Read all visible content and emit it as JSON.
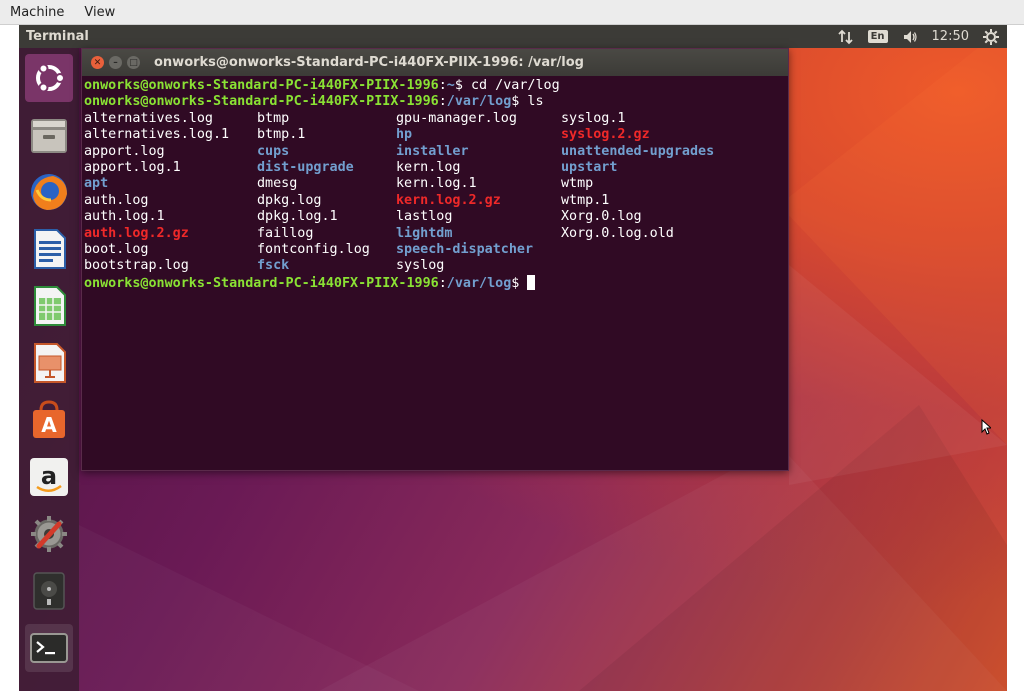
{
  "host_menu": {
    "items": [
      "Machine",
      "View"
    ]
  },
  "top_panel": {
    "app_title": "Terminal",
    "language": "En",
    "time": "12:50"
  },
  "launcher": {
    "items": [
      {
        "name": "dash-home",
        "icon": "ubuntu-logo-icon"
      },
      {
        "name": "files",
        "icon": "file-cabinet-icon"
      },
      {
        "name": "firefox",
        "icon": "firefox-icon"
      },
      {
        "name": "writer",
        "icon": "libreoffice-writer-icon"
      },
      {
        "name": "calc",
        "icon": "libreoffice-calc-icon"
      },
      {
        "name": "impress",
        "icon": "libreoffice-impress-icon"
      },
      {
        "name": "software-center",
        "icon": "ubuntu-software-icon"
      },
      {
        "name": "amazon",
        "icon": "amazon-icon"
      },
      {
        "name": "settings",
        "icon": "system-settings-icon"
      },
      {
        "name": "disks",
        "icon": "disk-icon"
      },
      {
        "name": "terminal",
        "icon": "terminal-icon"
      }
    ]
  },
  "terminal": {
    "title": "onworks@onworks-Standard-PC-i440FX-PIIX-1996: /var/log",
    "lines": [
      {
        "user": "onworks@onworks-Standard-PC-i440FX-PIIX-1996",
        "path": "~",
        "cmd": "cd /var/log"
      },
      {
        "user": "onworks@onworks-Standard-PC-i440FX-PIIX-1996",
        "path": "/var/log",
        "cmd": "ls"
      }
    ],
    "ls_rows": [
      [
        {
          "t": "alternatives.log",
          "k": "f-normal"
        },
        {
          "t": "btmp",
          "k": "f-normal"
        },
        {
          "t": "gpu-manager.log",
          "k": "f-normal"
        },
        {
          "t": "syslog.1",
          "k": "f-normal"
        }
      ],
      [
        {
          "t": "alternatives.log.1",
          "k": "f-normal"
        },
        {
          "t": "btmp.1",
          "k": "f-normal"
        },
        {
          "t": "hp",
          "k": "f-dir"
        },
        {
          "t": "syslog.2.gz",
          "k": "f-gz"
        }
      ],
      [
        {
          "t": "apport.log",
          "k": "f-normal"
        },
        {
          "t": "cups",
          "k": "f-dir"
        },
        {
          "t": "installer",
          "k": "f-dir"
        },
        {
          "t": "unattended-upgrades",
          "k": "f-dir"
        }
      ],
      [
        {
          "t": "apport.log.1",
          "k": "f-normal"
        },
        {
          "t": "dist-upgrade",
          "k": "f-dir"
        },
        {
          "t": "kern.log",
          "k": "f-normal"
        },
        {
          "t": "upstart",
          "k": "f-dir"
        }
      ],
      [
        {
          "t": "apt",
          "k": "f-dir"
        },
        {
          "t": "dmesg",
          "k": "f-normal"
        },
        {
          "t": "kern.log.1",
          "k": "f-normal"
        },
        {
          "t": "wtmp",
          "k": "f-normal"
        }
      ],
      [
        {
          "t": "auth.log",
          "k": "f-normal"
        },
        {
          "t": "dpkg.log",
          "k": "f-normal"
        },
        {
          "t": "kern.log.2.gz",
          "k": "f-gz"
        },
        {
          "t": "wtmp.1",
          "k": "f-normal"
        }
      ],
      [
        {
          "t": "auth.log.1",
          "k": "f-normal"
        },
        {
          "t": "dpkg.log.1",
          "k": "f-normal"
        },
        {
          "t": "lastlog",
          "k": "f-normal"
        },
        {
          "t": "Xorg.0.log",
          "k": "f-normal"
        }
      ],
      [
        {
          "t": "auth.log.2.gz",
          "k": "f-gz"
        },
        {
          "t": "faillog",
          "k": "f-normal"
        },
        {
          "t": "lightdm",
          "k": "f-dir"
        },
        {
          "t": "Xorg.0.log.old",
          "k": "f-normal"
        }
      ],
      [
        {
          "t": "boot.log",
          "k": "f-normal"
        },
        {
          "t": "fontconfig.log",
          "k": "f-normal"
        },
        {
          "t": "speech-dispatcher",
          "k": "f-dir"
        },
        {
          "t": "",
          "k": "f-normal"
        }
      ],
      [
        {
          "t": "bootstrap.log",
          "k": "f-normal"
        },
        {
          "t": "fsck",
          "k": "f-dir"
        },
        {
          "t": "syslog",
          "k": "f-normal"
        },
        {
          "t": "",
          "k": "f-normal"
        }
      ]
    ],
    "final_prompt": {
      "user": "onworks@onworks-Standard-PC-i440FX-PIIX-1996",
      "path": "/var/log"
    }
  }
}
